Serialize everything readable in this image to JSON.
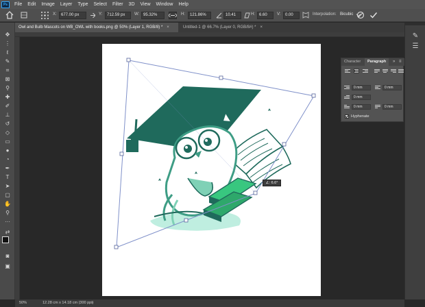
{
  "menubar": {
    "logo": "Ps",
    "items": [
      "File",
      "Edit",
      "Image",
      "Layer",
      "Type",
      "Select",
      "Filter",
      "3D",
      "View",
      "Window",
      "Help"
    ]
  },
  "options": {
    "x_label": "X:",
    "x_value": "677.00 px",
    "y_label": "Y:",
    "y_value": "712.59 px",
    "w_label": "W:",
    "w_value": "95.32%",
    "h_label": "H:",
    "h_value": "121.86%",
    "angle_value": "10.41",
    "hskew_label": "H:",
    "hskew_value": "6.60",
    "vskew_label": "V:",
    "vskew_value": "0.00",
    "interp_label": "Interpolation:",
    "interp_value": "Bicubic"
  },
  "tabs": [
    {
      "label": "Owl and Bulb Mascots on WB_OWL with books.png @ 50% (Layer 1, RGB/8) *",
      "close": "×"
    },
    {
      "label": "Untitled-1 @ 66.7% (Layer 0, RGB/8#) *",
      "close": "×"
    }
  ],
  "panel": {
    "tabs": [
      "Character",
      "Paragraph"
    ],
    "fields": [
      "0 mm",
      "0 mm",
      "0 mm",
      "0 mm",
      "0 mm"
    ],
    "hyphenate": "Hyphenate"
  },
  "transform_tooltip": "∠: 6.6°",
  "status": {
    "zoom": "50%",
    "doc_info": "12.28 cm x 14.18 cm (300 ppi)"
  },
  "colors": {
    "owl_dark": "#1f6a5c",
    "owl_mid": "#3e9d85",
    "owl_light": "#7fd1b6",
    "book_green": "#38c77f",
    "bbox": "#7f90c9"
  }
}
